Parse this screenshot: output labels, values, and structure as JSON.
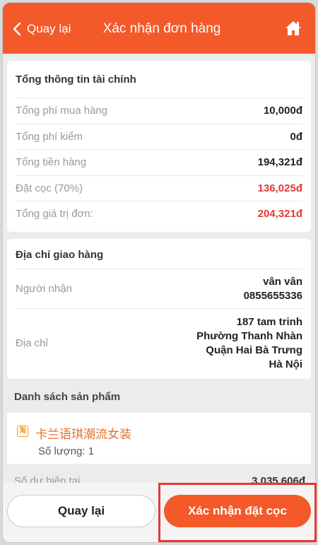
{
  "header": {
    "back_label": "Quay lại",
    "title": "Xác nhận đơn hàng",
    "home_icon": "home-icon",
    "color": "#f4592a"
  },
  "financial": {
    "title": "Tổng thông tin tài chính",
    "rows": [
      {
        "label": "Tổng phí mua hàng",
        "value": "10,000đ"
      },
      {
        "label": "Tổng phí kiểm",
        "value": "0đ"
      },
      {
        "label": "Tổng tiền hàng",
        "value": "194,321đ"
      },
      {
        "label": "Đặt cọc (70%)",
        "value": "136,025đ"
      },
      {
        "label": "Tổng giá trị đơn:",
        "value": "204,321đ"
      }
    ]
  },
  "shipping": {
    "title": "Địa chỉ giao hàng",
    "recipient_label": "Người nhận",
    "recipient_name": "vân vân",
    "recipient_phone": "0855655336",
    "address_label": "Địa chỉ",
    "address_lines": [
      "187 tam trinh",
      "Phường Thanh Nhàn",
      "Quận Hai Bà Trưng",
      "Hà Nội"
    ]
  },
  "products": {
    "title": "Danh sách sản phẩm",
    "shop_icon_text": "淘",
    "shop_name": "卡兰语琪潮流女装",
    "quantity": "Số lượng: 1"
  },
  "balance": {
    "label": "Số dư hiện tại",
    "value": "3,035,606đ"
  },
  "footer": {
    "back_label": "Quay lại",
    "confirm_label": "Xác nhận đặt cọc"
  }
}
